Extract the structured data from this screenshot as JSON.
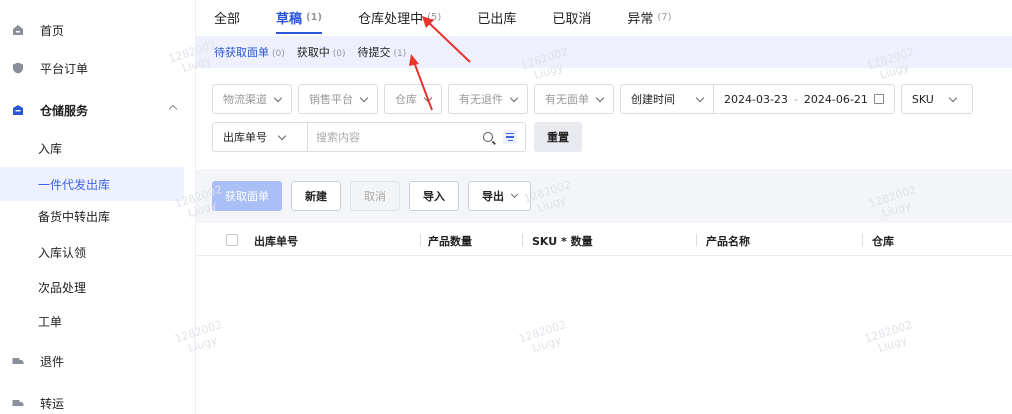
{
  "sidebar": {
    "items": [
      {
        "label": "首页"
      },
      {
        "label": "平台订单"
      },
      {
        "label": "仓储服务"
      },
      {
        "label": "入库"
      },
      {
        "label": "一件代发出库"
      },
      {
        "label": "备货中转出库"
      },
      {
        "label": "入库认领"
      },
      {
        "label": "次品处理"
      },
      {
        "label": "工单"
      },
      {
        "label": "退件"
      },
      {
        "label": "转运"
      }
    ]
  },
  "tabs": [
    {
      "label": "全部",
      "count": ""
    },
    {
      "label": "草稿",
      "count": "(1)"
    },
    {
      "label": "仓库处理中",
      "count": "(5)"
    },
    {
      "label": "已出库",
      "count": ""
    },
    {
      "label": "已取消",
      "count": ""
    },
    {
      "label": "异常",
      "count": "(7)"
    }
  ],
  "subtabs": [
    {
      "label": "待获取面单",
      "count": "(0)"
    },
    {
      "label": "获取中",
      "count": "(0)"
    },
    {
      "label": "待提交",
      "count": "(1)"
    }
  ],
  "filters": {
    "channel": "物流渠道",
    "platform": "销售平台",
    "warehouse": "仓库",
    "has_return": "有无退件",
    "has_label": "有无面单",
    "date_type": "创建时间",
    "date_start": "2024-03-23",
    "date_sep": "-",
    "date_end": "2024-06-21",
    "sku": "SKU",
    "field": "出库单号",
    "search_placeholder": "搜索内容",
    "reset": "重置"
  },
  "toolbar": {
    "get_label": "获取面单",
    "create": "新建",
    "cancel": "取消",
    "import": "导入",
    "export": "导出"
  },
  "table": {
    "columns": [
      "出库单号",
      "产品数量",
      "SKU * 数量",
      "产品名称",
      "仓库"
    ]
  },
  "watermark": [
    "1282002",
    "Liugy"
  ],
  "colors": {
    "accent": "#2b56d8",
    "annotation_arrow": "#e8322a"
  }
}
